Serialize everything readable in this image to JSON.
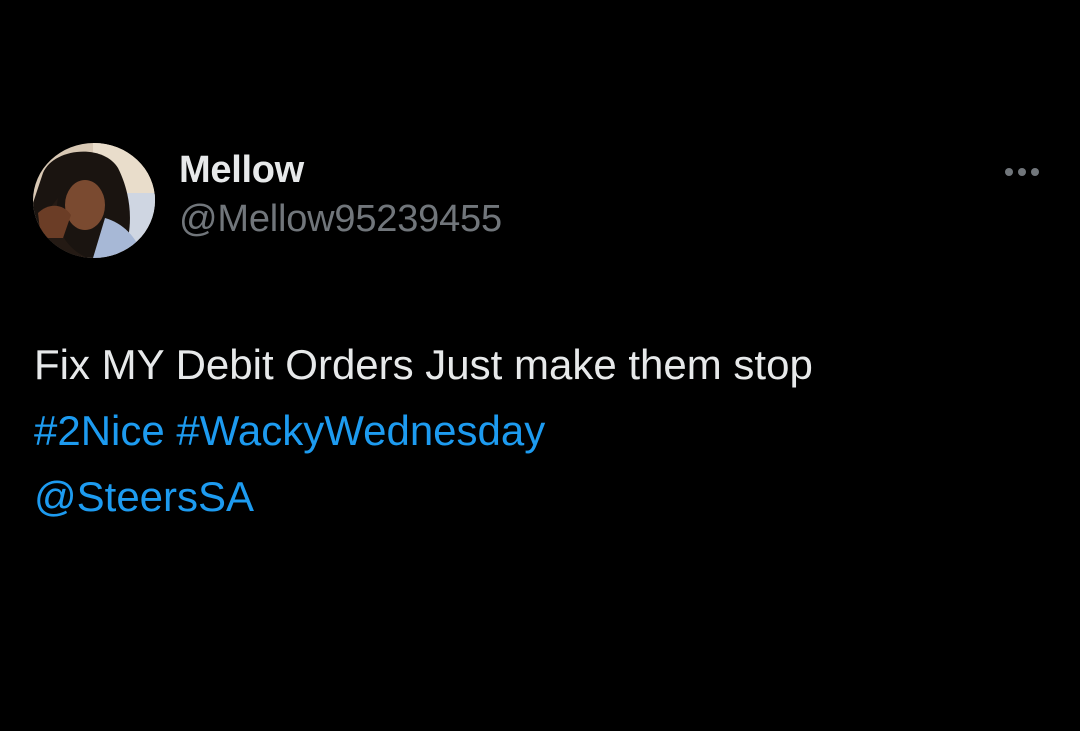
{
  "theme": {
    "background": "#000000",
    "text": "#e7e9ea",
    "secondary_text": "#71767b",
    "link": "#1d9bf0"
  },
  "tweet": {
    "author": {
      "display_name": "Mellow",
      "handle": "@Mellow95239455",
      "avatar_icon": "profile-photo"
    },
    "more_icon": "more-horizontal-icon",
    "text_line_1": "Fix MY Debit Orders Just make them stop",
    "hashtags": [
      "#2Nice",
      "#WackyWednesday"
    ],
    "mention": "@SteersSA"
  }
}
